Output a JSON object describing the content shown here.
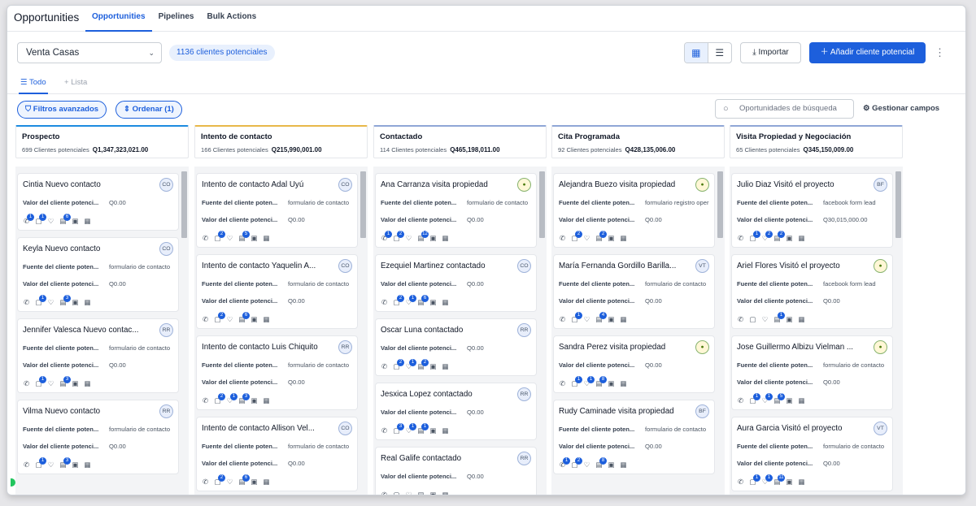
{
  "app": {
    "title": "Opportunities",
    "tabs": [
      "Opportunities",
      "Pipelines",
      "Bulk Actions"
    ]
  },
  "toolbar": {
    "pipeline": "Venta Casas",
    "count": "1136 clientes potenciales",
    "import_label": "Importar",
    "add_label": "Añadir cliente potencial",
    "more": "⋮"
  },
  "subtabs": {
    "all": "Todo",
    "add_list": "Lista"
  },
  "filters": {
    "advanced": "Filtros avanzados",
    "sort": "Ordenar (1)",
    "search_placeholder": "Oportunidades de búsqueda",
    "manage_fields": "Gestionar campos"
  },
  "colors": {
    "accent": "#1d5fdc",
    "prospect": "#1d8be0",
    "contact_attempt": "#e8b84a",
    "contacted": "#8fa6d6",
    "scheduled": "#8fa6d6",
    "visit": "#8fa6d6"
  },
  "columns": [
    {
      "name": "Prospecto",
      "count": "699 Clientes potenciales",
      "value": "Q1,347,323,021.00",
      "cards": [
        {
          "title": "Cintia Nuevo contacto",
          "avatar": "CO",
          "rows": [
            {
              "k": "Valor del cliente potenci...",
              "v": "Q0.00"
            }
          ],
          "badges": [
            "1",
            "1",
            "",
            "6"
          ]
        },
        {
          "title": "Keyla Nuevo contacto",
          "avatar": "CO",
          "rows": [
            {
              "k": "Fuente del cliente poten...",
              "v": "formulario de contacto"
            },
            {
              "k": "Valor del cliente potenci...",
              "v": "Q0.00"
            }
          ],
          "badges": [
            "",
            "1",
            "",
            "3"
          ]
        },
        {
          "title": "Jennifer Valesca Nuevo contac...",
          "avatar": "RR",
          "rows": [
            {
              "k": "Fuente del cliente poten...",
              "v": "formulario de contacto"
            },
            {
              "k": "Valor del cliente potenci...",
              "v": "Q0.00"
            }
          ],
          "badges": [
            "",
            "1",
            "",
            "3"
          ]
        },
        {
          "title": "Vilma Nuevo contacto",
          "avatar": "RR",
          "rows": [
            {
              "k": "Fuente del cliente poten...",
              "v": "formulario de contacto"
            },
            {
              "k": "Valor del cliente potenci...",
              "v": "Q0.00"
            }
          ],
          "badges": [
            "",
            "1",
            "",
            "3"
          ]
        }
      ]
    },
    {
      "name": "Intento de contacto",
      "count": "166 Clientes potenciales",
      "value": "Q215,990,001.00",
      "cards": [
        {
          "title": "Intento de contacto Adal Uyú",
          "avatar": "CO",
          "rows": [
            {
              "k": "Fuente del cliente poten...",
              "v": "formulario de contacto"
            },
            {
              "k": "Valor del cliente potenci...",
              "v": "Q0.00"
            }
          ],
          "badges": [
            "",
            "2",
            "",
            "5"
          ]
        },
        {
          "title": "Intento de contacto Yaquelin A...",
          "avatar": "CO",
          "rows": [
            {
              "k": "Fuente del cliente poten...",
              "v": "formulario de contacto"
            },
            {
              "k": "Valor del cliente potenci...",
              "v": "Q0.00"
            }
          ],
          "badges": [
            "",
            "2",
            "",
            "6"
          ]
        },
        {
          "title": "Intento de contacto Luis Chiquito",
          "avatar": "RR",
          "rows": [
            {
              "k": "Fuente del cliente poten...",
              "v": "formulario de contacto"
            },
            {
              "k": "Valor del cliente potenci...",
              "v": "Q0.00"
            }
          ],
          "badges": [
            "",
            "2",
            "1",
            "3"
          ]
        },
        {
          "title": "Intento de contacto Allison Vel...",
          "avatar": "CO",
          "rows": [
            {
              "k": "Fuente del cliente poten...",
              "v": "formulario de contacto"
            },
            {
              "k": "Valor del cliente potenci...",
              "v": "Q0.00"
            }
          ],
          "badges": [
            "",
            "2",
            "",
            "6"
          ]
        }
      ]
    },
    {
      "name": "Contactado",
      "count": "114 Clientes potenciales",
      "value": "Q465,198,011.00",
      "cards": [
        {
          "title": "Ana Carranza visita propiedad",
          "avatar": "●",
          "logo": true,
          "rows": [
            {
              "k": "Fuente del cliente poten...",
              "v": "formulario de contacto"
            },
            {
              "k": "Valor del cliente potenci...",
              "v": "Q0.00"
            }
          ],
          "badges": [
            "1",
            "2",
            "",
            "12"
          ]
        },
        {
          "title": "Ezequiel Martinez contactado",
          "avatar": "CO",
          "rows": [
            {
              "k": "Valor del cliente potenci...",
              "v": "Q0.00"
            }
          ],
          "badges": [
            "",
            "2",
            "1",
            "6"
          ]
        },
        {
          "title": "Oscar Luna contactado",
          "avatar": "RR",
          "rows": [
            {
              "k": "Valor del cliente potenci...",
              "v": "Q0.00"
            }
          ],
          "badges": [
            "",
            "2",
            "1",
            "2"
          ]
        },
        {
          "title": "Jesxica Lopez contactado",
          "avatar": "RR",
          "rows": [
            {
              "k": "Valor del cliente potenci...",
              "v": "Q0.00"
            }
          ],
          "badges": [
            "",
            "3",
            "1",
            "1"
          ]
        },
        {
          "title": "Real Galife contactado",
          "avatar": "RR",
          "rows": [
            {
              "k": "Valor del cliente potenci...",
              "v": "Q0.00"
            }
          ],
          "badges": []
        }
      ]
    },
    {
      "name": "Cita Programada",
      "count": "92 Clientes potenciales",
      "value": "Q428,135,006.00",
      "cards": [
        {
          "title": "Alejandra Buezo visita propiedad",
          "avatar": "●",
          "logo": true,
          "rows": [
            {
              "k": "Fuente del cliente poten...",
              "v": "formulario registro oper"
            },
            {
              "k": "Valor del cliente potenci...",
              "v": "Q0.00"
            }
          ],
          "badges": [
            "",
            "2",
            "",
            "2"
          ]
        },
        {
          "title": "María Fernanda Gordillo Barilla...",
          "avatar": "VT",
          "rows": [
            {
              "k": "Fuente del cliente poten...",
              "v": "formulario de contacto"
            },
            {
              "k": "Valor del cliente potenci...",
              "v": "Q0.00"
            }
          ],
          "badges": [
            "",
            "1",
            "",
            "4"
          ]
        },
        {
          "title": "Sandra Perez visita propiedad",
          "avatar": "●",
          "logo": true,
          "rows": [
            {
              "k": "Valor del cliente potenci...",
              "v": "Q0.00"
            }
          ],
          "badges": [
            "",
            "1",
            "1",
            "8"
          ]
        },
        {
          "title": "Rudy Caminade visita propiedad",
          "avatar": "BF",
          "rows": [
            {
              "k": "Fuente del cliente poten...",
              "v": "formulario de contacto"
            },
            {
              "k": "Valor del cliente potenci...",
              "v": "Q0.00"
            }
          ],
          "badges": [
            "1",
            "2",
            "",
            "8"
          ]
        }
      ]
    },
    {
      "name": "Visita Propiedad y Negociación",
      "count": "65 Clientes potenciales",
      "value": "Q345,150,009.00",
      "cards": [
        {
          "title": "Julio Diaz Visitó el proyecto",
          "avatar": "BF",
          "rows": [
            {
              "k": "Fuente del cliente poten...",
              "v": "facebook form lead"
            },
            {
              "k": "Valor del cliente potenci...",
              "v": "Q30,015,000.00"
            }
          ],
          "badges": [
            "",
            "1",
            "2",
            "2"
          ]
        },
        {
          "title": "Ariel Flores Visitó el proyecto",
          "avatar": "●",
          "logo": true,
          "rows": [
            {
              "k": "Fuente del cliente poten...",
              "v": "facebook form lead"
            },
            {
              "k": "Valor del cliente potenci...",
              "v": "Q0.00"
            }
          ],
          "badges": [
            "",
            "",
            "",
            "1"
          ]
        },
        {
          "title": "Jose Guillermo Albizu Vielman ...",
          "avatar": "●",
          "logo": true,
          "rows": [
            {
              "k": "Fuente del cliente poten...",
              "v": "formulario de contacto"
            },
            {
              "k": "Valor del cliente potenci...",
              "v": "Q0.00"
            }
          ],
          "badges": [
            "",
            "1",
            "1",
            "5"
          ]
        },
        {
          "title": "Aura Garcia Visitó el proyecto",
          "avatar": "VT",
          "rows": [
            {
              "k": "Fuente del cliente poten...",
              "v": "formulario de contacto"
            },
            {
              "k": "Valor del cliente potenci...",
              "v": "Q0.00"
            }
          ],
          "badges": [
            "",
            "1",
            "1",
            "11"
          ]
        }
      ]
    }
  ]
}
